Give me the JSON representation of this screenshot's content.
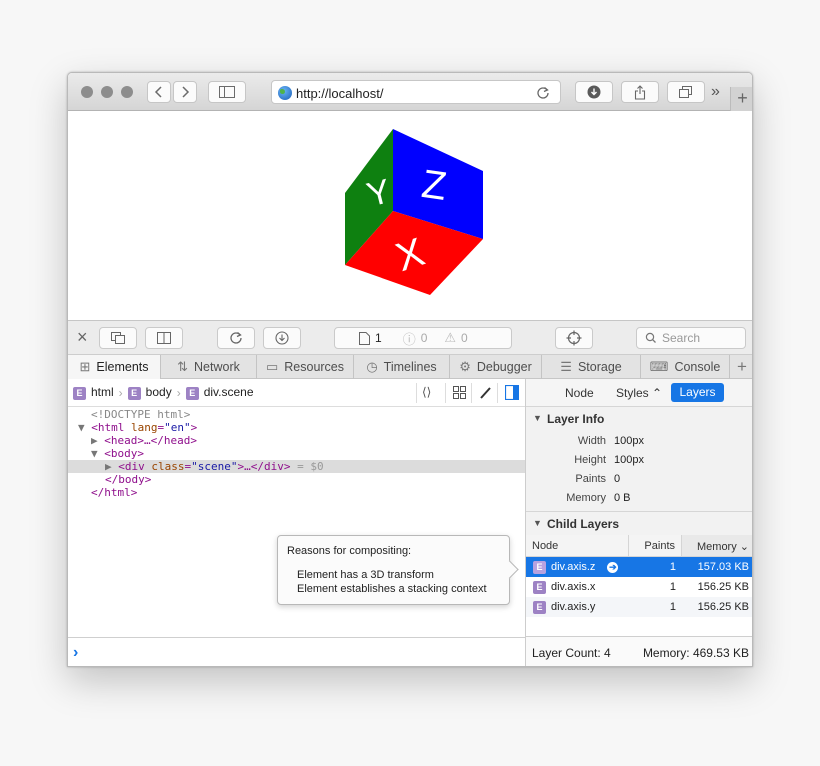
{
  "browser": {
    "url": "http://localhost/",
    "more_glyph": "»",
    "new_tab": "+"
  },
  "scene": {
    "face_y": "Y",
    "face_z": "Z",
    "face_x": "X",
    "colors": {
      "y": "#0e8010",
      "z": "#0000ff",
      "x": "#ff0000"
    }
  },
  "devtools_toolbar": {
    "close": "×",
    "resource_count": "1",
    "error_count": "0",
    "warning_count": "0",
    "search_placeholder": "Search"
  },
  "tabs": [
    {
      "label": "Elements",
      "icon": "elements-icon"
    },
    {
      "label": "Network",
      "icon": "network-icon"
    },
    {
      "label": "Resources",
      "icon": "resources-icon"
    },
    {
      "label": "Timelines",
      "icon": "timelines-icon"
    },
    {
      "label": "Debugger",
      "icon": "debugger-icon"
    },
    {
      "label": "Storage",
      "icon": "storage-icon"
    },
    {
      "label": "Console",
      "icon": "console-icon"
    }
  ],
  "tab_add": "+",
  "breadcrumb": [
    {
      "badge": "E",
      "label": "html"
    },
    {
      "badge": "E",
      "label": "body"
    },
    {
      "badge": "E",
      "label": "div.scene"
    }
  ],
  "dom": {
    "doctype": "<!DOCTYPE html>",
    "html_open": "<html",
    "html_attr_name": "lang",
    "html_attr_eq": "=",
    "html_attr_value": "\"en\"",
    "html_close_bracket": ">",
    "head": "<head>…</head>",
    "body_open": "<body>",
    "div_open": "<div",
    "div_attr_name": "class",
    "div_attr_eq": "=",
    "div_attr_value": "\"scene\"",
    "div_rest": ">…</div>",
    "div_ref": " = $0",
    "body_close": "</body>",
    "html_close": "</html>"
  },
  "tooltip": {
    "title": "Reasons for compositing:",
    "reason_1": "Element has a 3D transform",
    "reason_2": "Element establishes a stacking context"
  },
  "sidebar": {
    "tabs": {
      "node": "Node",
      "styles": "Styles ⌃",
      "layers": "Layers"
    },
    "layer_info": {
      "title": "Layer Info",
      "width_label": "Width",
      "width_value": "100px",
      "height_label": "Height",
      "height_value": "100px",
      "paints_label": "Paints",
      "paints_value": "0",
      "memory_label": "Memory",
      "memory_value": "0 B"
    },
    "child_layers": {
      "title": "Child Layers",
      "columns": {
        "node": "Node",
        "paints": "Paints",
        "memory": "Memory ⌄"
      },
      "rows": [
        {
          "node": "div.axis.z",
          "paints": "1",
          "memory": "157.03 KB"
        },
        {
          "node": "div.axis.x",
          "paints": "1",
          "memory": "156.25 KB"
        },
        {
          "node": "div.axis.y",
          "paints": "1",
          "memory": "156.25 KB"
        }
      ]
    },
    "footer": {
      "layer_count": "Layer Count: 4",
      "memory": "Memory: 469.53 KB"
    }
  },
  "console": {
    "prompt": "›"
  }
}
